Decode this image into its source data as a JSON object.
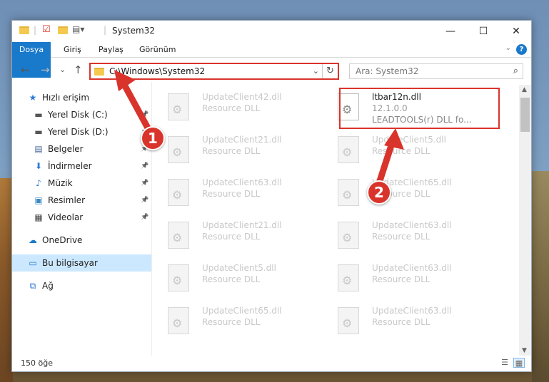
{
  "window": {
    "title": "System32",
    "controls": {
      "minimize": "—",
      "maximize": "☐",
      "close": "✕"
    }
  },
  "ribbon": {
    "tabs": [
      "Dosya",
      "Giriş",
      "Paylaş",
      "Görünüm"
    ],
    "help": "?"
  },
  "navigation": {
    "back": "←",
    "forward": "→",
    "recent": "⌄",
    "up": "↑",
    "address": "C:\\Windows\\System32",
    "search_placeholder": "Ara: System32"
  },
  "sidebar": {
    "items": [
      {
        "label": "Hızlı erişim",
        "icon": "star-icon",
        "glyph": "★",
        "color": "#2d7ad6"
      },
      {
        "label": "Yerel Disk (C:)",
        "icon": "drive-icon",
        "glyph": "▬",
        "color": "#555555",
        "pinned": true
      },
      {
        "label": "Yerel Disk (D:)",
        "icon": "drive-icon",
        "glyph": "▬",
        "color": "#555555",
        "pinned": true
      },
      {
        "label": "Belgeler",
        "icon": "documents-icon",
        "glyph": "▤",
        "color": "#4a6a9a",
        "pinned": true
      },
      {
        "label": "İndirmeler",
        "icon": "download-icon",
        "glyph": "⬇",
        "color": "#2d7ad6",
        "pinned": true
      },
      {
        "label": "Müzik",
        "icon": "music-icon",
        "glyph": "♪",
        "color": "#2d7ad6",
        "pinned": true
      },
      {
        "label": "Resimler",
        "icon": "pictures-icon",
        "glyph": "▣",
        "color": "#3a8ac6",
        "pinned": true
      },
      {
        "label": "Videolar",
        "icon": "videos-icon",
        "glyph": "▦",
        "color": "#444444",
        "pinned": true
      },
      {
        "label": "OneDrive",
        "icon": "cloud-icon",
        "glyph": "☁",
        "color": "#1979ca"
      },
      {
        "label": "Bu bilgisayar",
        "icon": "computer-icon",
        "glyph": "▭",
        "color": "#2d7ad6",
        "selected": true
      },
      {
        "label": "Ağ",
        "icon": "network-icon",
        "glyph": "⧉",
        "color": "#2d7ad6"
      }
    ]
  },
  "files": {
    "left": [
      {
        "name": "UpdateClient42.dll",
        "desc": "Resource DLL"
      },
      {
        "name": "UpdateClient21.dll",
        "desc": "Resource DLL"
      },
      {
        "name": "UpdateClient63.dll",
        "desc": "Resource DLL"
      },
      {
        "name": "UpdateClient21.dll",
        "desc": "Resource DLL"
      },
      {
        "name": "UpdateClient5.dll",
        "desc": "Resource DLL"
      },
      {
        "name": "UpdateClient65.dll",
        "desc": "Resource DLL"
      }
    ],
    "right": [
      {
        "name": "ltbar12n.dll",
        "version": "12.1.0.0",
        "desc": "LEADTOOLS(r) DLL fo...",
        "highlighted": true
      },
      {
        "name": "UpdateClient5.dll",
        "desc": "Resource DLL"
      },
      {
        "name": "UpdateClient65.dll",
        "desc": "Resource DLL"
      },
      {
        "name": "UpdateClient63.dll",
        "desc": "Resource DLL"
      },
      {
        "name": "UpdateClient63.dll",
        "desc": "Resource DLL"
      },
      {
        "name": "UpdateClient63.dll",
        "desc": "Resource DLL"
      }
    ]
  },
  "status": {
    "count": "150 öğe"
  },
  "annotations": {
    "step1": "1",
    "step2": "2",
    "color": "#d9342b"
  }
}
